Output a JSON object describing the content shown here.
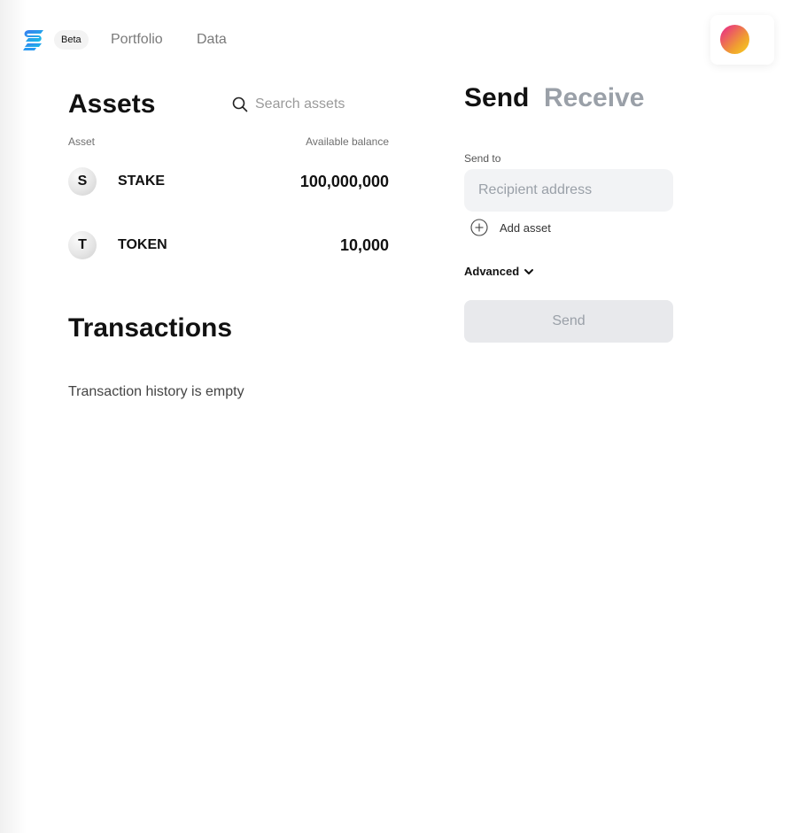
{
  "header": {
    "beta_badge": "Beta",
    "nav": [
      {
        "label": "Portfolio"
      },
      {
        "label": "Data"
      }
    ],
    "logo_icon": "stacked-s-logo-icon",
    "logo_color": "#1b8cf0"
  },
  "assets": {
    "title": "Assets",
    "search_placeholder": "Search assets",
    "column_asset": "Asset",
    "column_balance": "Available balance",
    "items": [
      {
        "initial": "S",
        "name": "STAKE",
        "balance": "100,000,000"
      },
      {
        "initial": "T",
        "name": "TOKEN",
        "balance": "10,000"
      }
    ]
  },
  "transactions": {
    "title": "Transactions",
    "empty_text": "Transaction history is empty"
  },
  "send_panel": {
    "tab_send": "Send",
    "tab_receive": "Receive",
    "send_to_label": "Send to",
    "recipient_placeholder": "Recipient address",
    "add_asset_label": "Add asset",
    "advanced_label": "Advanced",
    "send_button": "Send"
  },
  "colors": {
    "inactive_tab": "#9aa0a8",
    "input_bg": "#f2f3f5",
    "button_disabled_bg": "#e8e9ec"
  }
}
